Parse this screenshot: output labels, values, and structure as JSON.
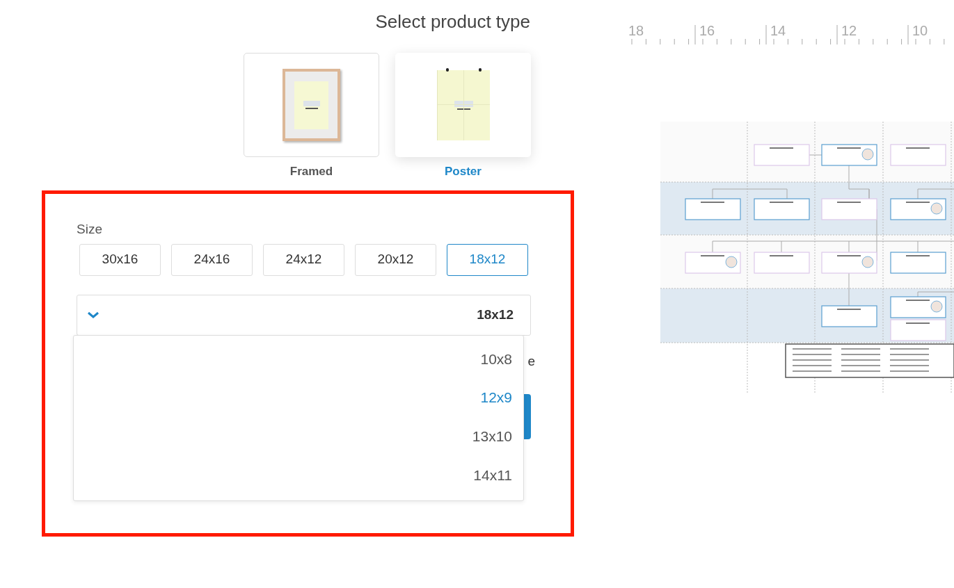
{
  "heading": "Select product type",
  "product_types": [
    {
      "label": "Framed",
      "kind": "framed",
      "selected": false
    },
    {
      "label": "Poster",
      "kind": "poster",
      "selected": true
    }
  ],
  "size_label": "Size",
  "sizes": [
    {
      "label": "30x16",
      "selected": false
    },
    {
      "label": "24x16",
      "selected": false
    },
    {
      "label": "24x12",
      "selected": false
    },
    {
      "label": "20x12",
      "selected": false
    },
    {
      "label": "18x12",
      "selected": true
    }
  ],
  "size_select": {
    "value": "18x12",
    "expanded": true,
    "options": [
      {
        "label": "10x8",
        "selected": false
      },
      {
        "label": "12x9",
        "selected": true
      },
      {
        "label": "13x10",
        "selected": false
      },
      {
        "label": "14x11",
        "selected": false
      }
    ]
  },
  "covered_text": "e",
  "ruler": {
    "labels": [
      "18",
      "16",
      "14",
      "12",
      "10"
    ]
  }
}
